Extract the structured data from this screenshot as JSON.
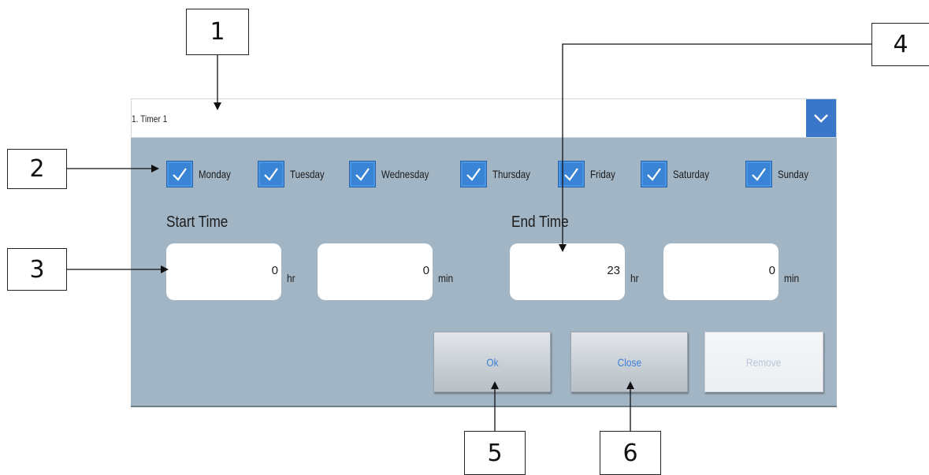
{
  "callouts": [
    "1",
    "2",
    "3",
    "4",
    "5",
    "6"
  ],
  "timer_select": {
    "value": "1. Timer 1",
    "icon": "chevron-down-icon"
  },
  "days": [
    {
      "label": "Monday",
      "checked": true
    },
    {
      "label": "Tuesday",
      "checked": true
    },
    {
      "label": "Wednesday",
      "checked": true
    },
    {
      "label": "Thursday",
      "checked": true
    },
    {
      "label": "Friday",
      "checked": true
    },
    {
      "label": "Saturday",
      "checked": true
    },
    {
      "label": "Sunday",
      "checked": true
    }
  ],
  "start_time": {
    "label": "Start Time",
    "hours": "0",
    "hours_unit": "hr",
    "minutes": "0",
    "minutes_unit": "min"
  },
  "end_time": {
    "label": "End Time",
    "hours": "23",
    "hours_unit": "hr",
    "minutes": "0",
    "minutes_unit": "min"
  },
  "buttons": {
    "ok": "Ok",
    "close": "Close",
    "remove": "Remove"
  },
  "colors": {
    "panel": "#a2b5c4",
    "checkbox": "#3a84d6",
    "accent_text": "#3b7fd6"
  }
}
